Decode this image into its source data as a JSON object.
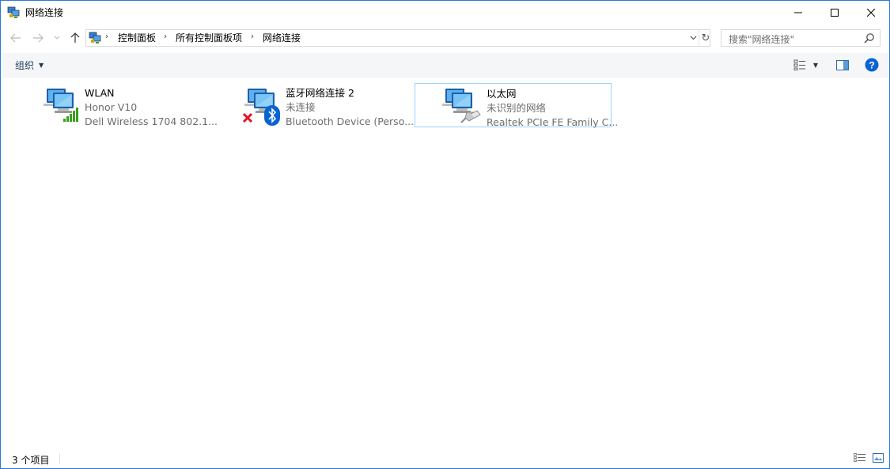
{
  "window": {
    "title": "网络连接",
    "colors": {
      "accent": "#2b79d8",
      "selection_border": "#99d1ff",
      "help_blue": "#0a63d2",
      "signal_green": "#37a11d",
      "error_red": "#e81123"
    }
  },
  "nav": {
    "breadcrumbs": [
      "控制面板",
      "所有控制面板项",
      "网络连接"
    ],
    "search_placeholder": "搜索\"网络连接\""
  },
  "toolbar": {
    "organize_label": "组织"
  },
  "items": [
    {
      "name": "WLAN",
      "status": "Honor V10",
      "device": "Dell Wireless 1704 802.1...",
      "overlay": "signal-bars-icon"
    },
    {
      "name": "蓝牙网络连接 2",
      "status": "未连接",
      "device": "Bluetooth Device (Perso...",
      "overlay": "bluetooth-icon"
    },
    {
      "name": "以太网",
      "status": "未识别的网络",
      "device": "Realtek PCIe FE Family C...",
      "overlay": "ethernet-cable-icon",
      "selected": true
    }
  ],
  "status": {
    "count_text": "3 个项目"
  }
}
